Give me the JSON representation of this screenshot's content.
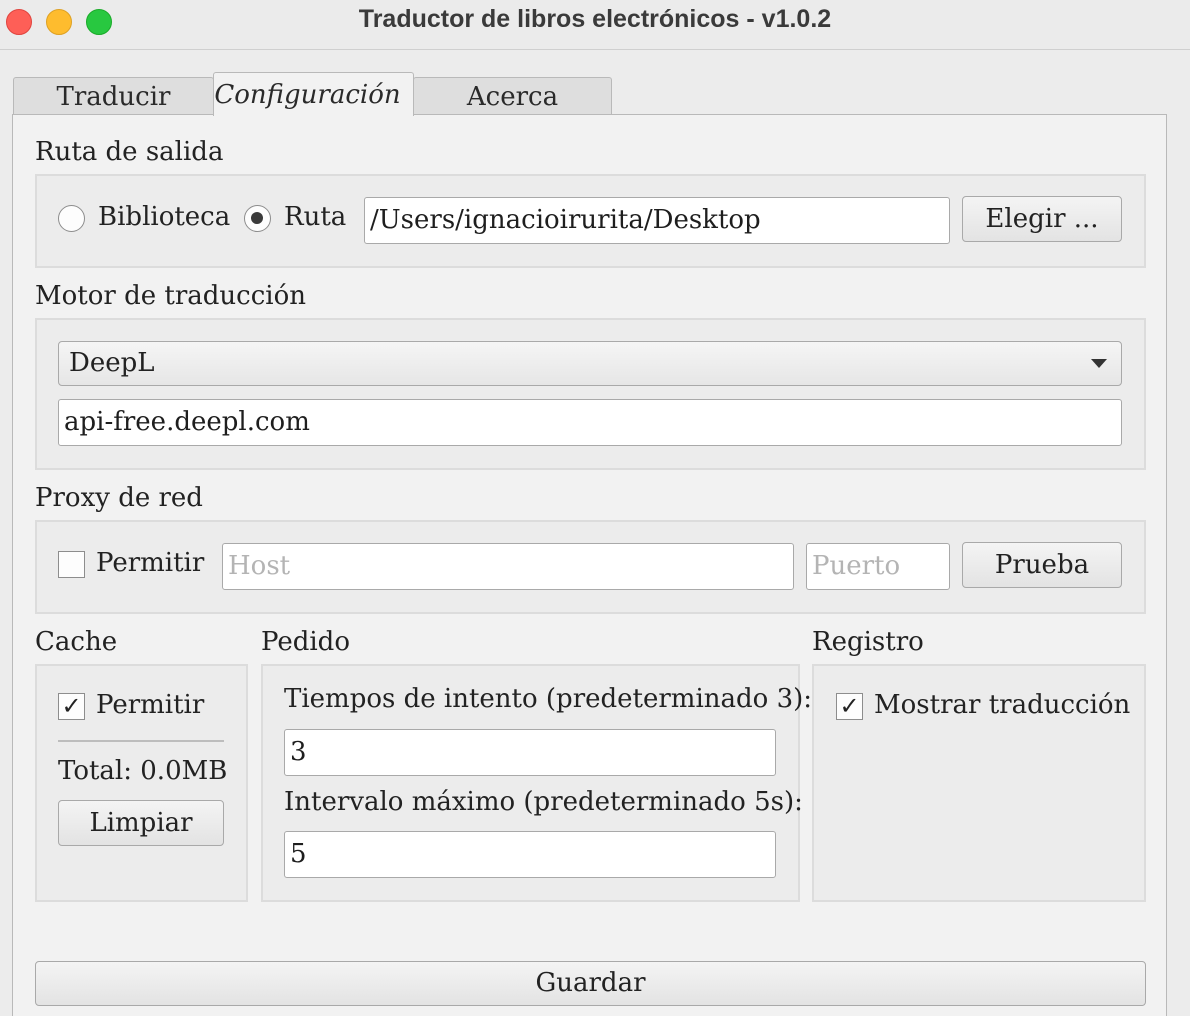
{
  "window": {
    "title": "Traductor de libros electrónicos - v1.0.2"
  },
  "tabs": [
    {
      "label": "Traducir",
      "active": false
    },
    {
      "label": "Configuración",
      "active": true
    },
    {
      "label": "Acerca",
      "active": false
    }
  ],
  "output_path": {
    "title": "Ruta de salida",
    "library_label": "Biblioteca",
    "library_selected": false,
    "path_label": "Ruta",
    "path_selected": true,
    "path_value": "/Users/ignacioirurita/Desktop",
    "choose_button": "Elegir ..."
  },
  "engine": {
    "title": "Motor de traducción",
    "selected": "DeepL",
    "endpoint": "api-free.deepl.com"
  },
  "proxy": {
    "title": "Proxy de red",
    "enable_label": "Permitir",
    "enabled": false,
    "host_placeholder": "Host",
    "port_placeholder": "Puerto",
    "test_button": "Prueba"
  },
  "cache": {
    "title": "Cache",
    "enable_label": "Permitir",
    "enabled": true,
    "total": "Total: 0.0MB",
    "clear_button": "Limpiar"
  },
  "request": {
    "title": "Pedido",
    "retry_label": "Tiempos de intento (predeterminado 3):",
    "retry_value": "3",
    "interval_label": "Intervalo máximo (predeterminado 5s):",
    "interval_value": "5"
  },
  "log": {
    "title": "Registro",
    "show_translation_label": "Mostrar traducción",
    "show_translation": true
  },
  "save_button": "Guardar",
  "icons": {
    "check_glyph": "✓"
  }
}
